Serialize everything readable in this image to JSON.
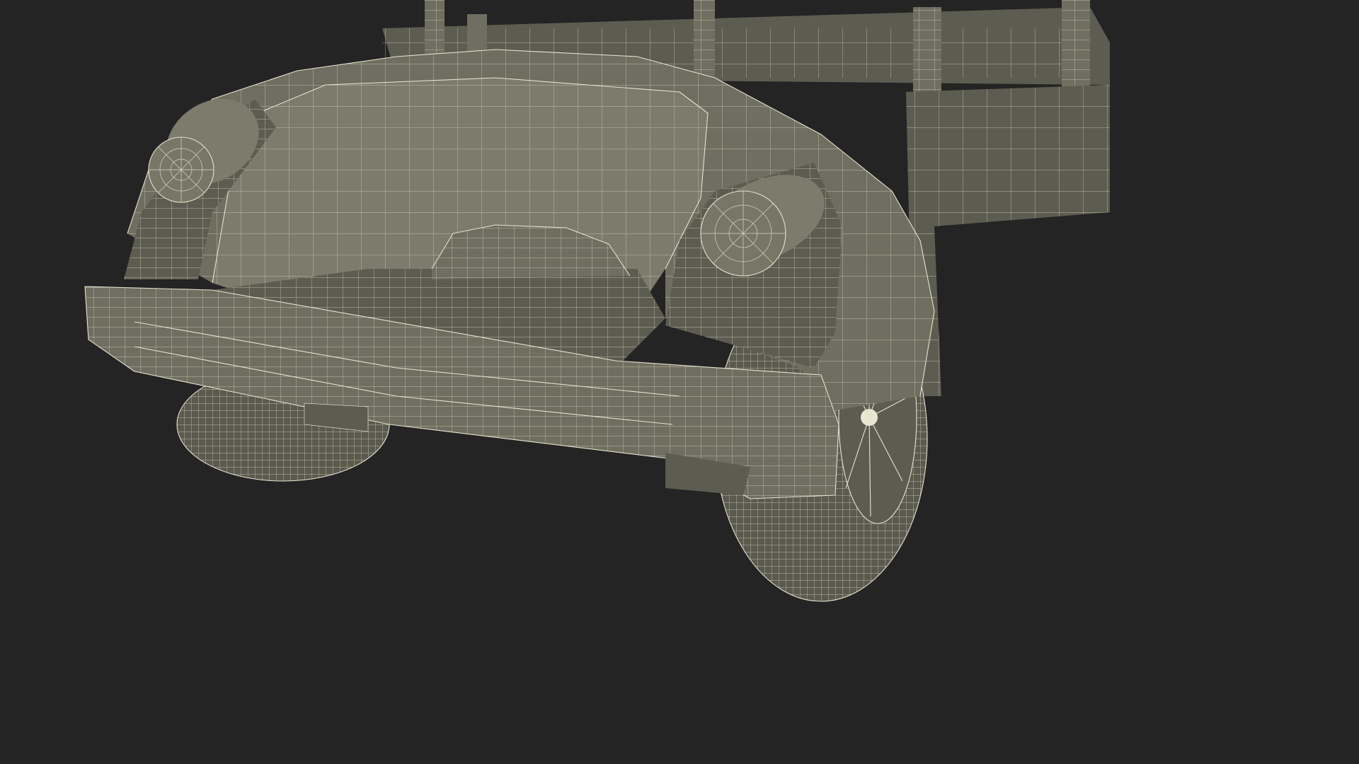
{
  "scene": {
    "background_color": "#242424",
    "model_fill_color": "#6f6e60",
    "wire_color": "#e6e4cf",
    "subject": "wireframe-vehicle-rear"
  }
}
